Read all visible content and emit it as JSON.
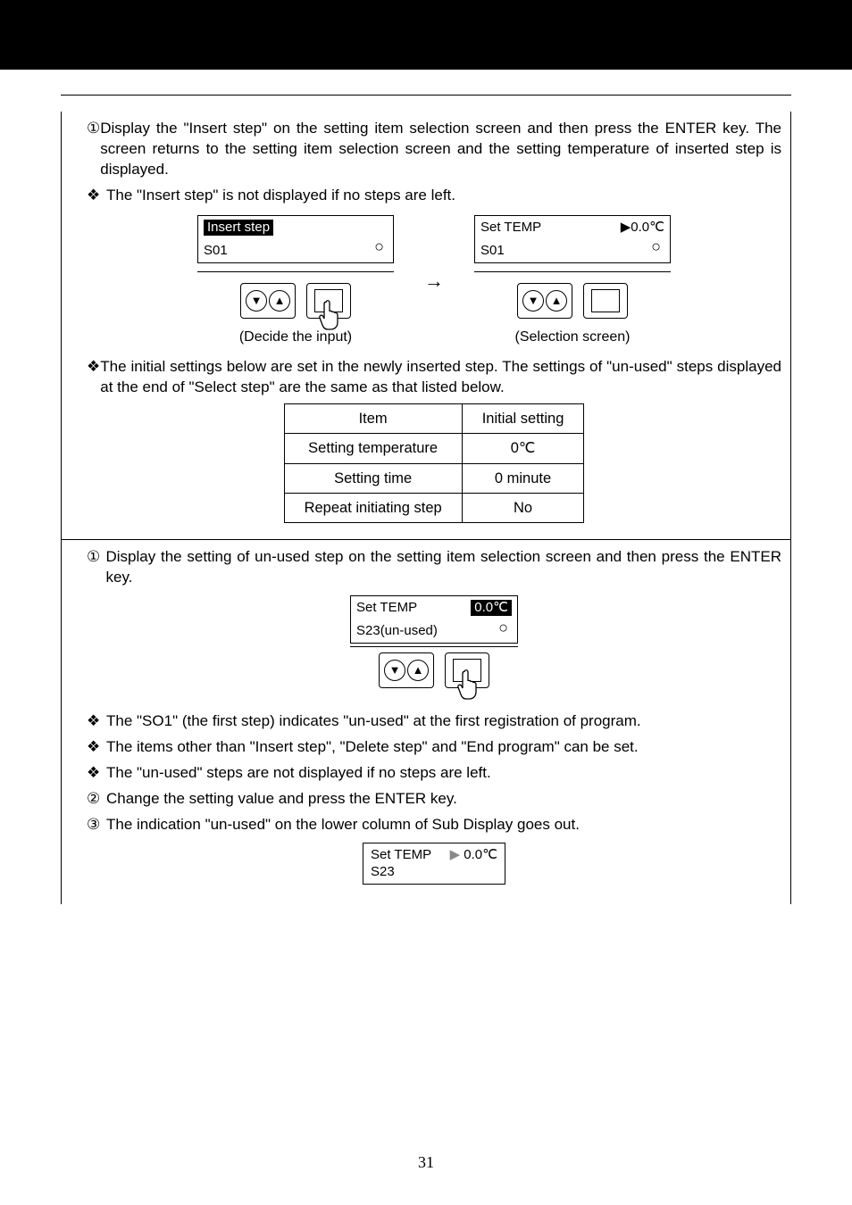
{
  "section1": {
    "p1": "Display the \"Insert step\" on the setting item selection screen and then press the ENTER key. The screen returns to the setting item selection screen and the setting temperature of inserted step is displayed.",
    "note1": "The \"Insert step\" is not displayed if no steps are left.",
    "scrA": {
      "label": "Insert step",
      "line2": "S01"
    },
    "scrB": {
      "line1_left": "Set TEMP",
      "line1_right": "▶0.0℃",
      "line2": "S01"
    },
    "cap_left": "(Decide the input)",
    "cap_right": "(Selection screen)",
    "note2": "The initial settings below are set in the newly inserted step.    The settings of \"un-used\" steps displayed at the end of \"Select step\" are the same as that listed below.",
    "table": {
      "h1": "Item",
      "h2": "Initial setting",
      "r1c1": "Setting temperature",
      "r1c2": "0℃",
      "r2c1": "Setting time",
      "r2c2": "0 minute",
      "r3c1": "Repeat initiating step",
      "r3c2": "No"
    }
  },
  "section2": {
    "p1": "Display the setting of un-used step on the setting item selection screen and then press the ENTER key.",
    "scrC": {
      "line1_left": "Set TEMP",
      "line1_right": "0.0℃",
      "line2": "S23(un-used)"
    },
    "note1": "The \"SO1\" (the first step) indicates \"un-used\" at the first registration of program.",
    "note2": "The items other than \"Insert step\", \"Delete step\" and \"End program\" can be set.",
    "note3": "The \"un-used\" steps are not displayed if no steps are left.",
    "p2": "Change the setting value and press the ENTER key.",
    "p3": "The indication \"un-used\" on the lower column of Sub Display goes out.",
    "scrD": {
      "line1_left": "Set TEMP",
      "line1_right": "0.0℃",
      "line2": "S23"
    }
  },
  "page_number": "31"
}
